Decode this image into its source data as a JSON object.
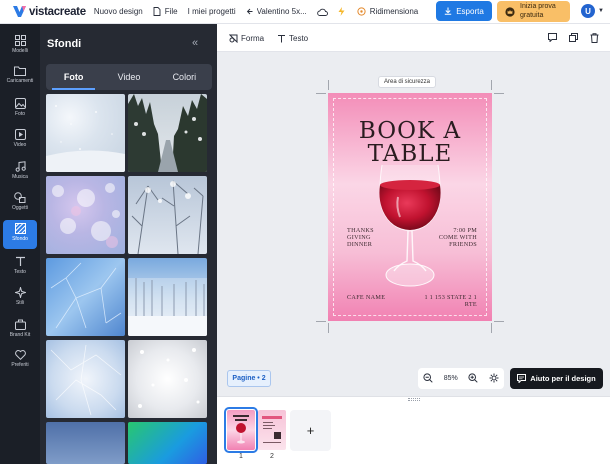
{
  "topbar": {
    "logo_text": "vistacreate",
    "new_design": "Nuovo design",
    "file": "File",
    "my_projects": "I miei progetti",
    "project_name": "Valentino 5x...",
    "resize": "Ridimensiona",
    "export": "Esporta",
    "trial_line1": "Inizia prova",
    "trial_line2": "gratuita",
    "avatar_letter": "U",
    "colors": {
      "export": "#1f79e3",
      "trial": "#f9bf67",
      "avatar": "#2364cf"
    }
  },
  "rail": {
    "items": [
      {
        "label": "Modelli",
        "icon": "templates-icon"
      },
      {
        "label": "Caricamenti",
        "icon": "folder-icon"
      },
      {
        "label": "Foto",
        "icon": "photo-icon"
      },
      {
        "label": "Video",
        "icon": "video-icon"
      },
      {
        "label": "Musica",
        "icon": "music-icon"
      },
      {
        "label": "Oggetti",
        "icon": "objects-icon"
      },
      {
        "label": "Sfondo",
        "icon": "background-icon"
      },
      {
        "label": "Testo",
        "icon": "text-icon"
      },
      {
        "label": "Stili",
        "icon": "styles-icon"
      },
      {
        "label": "Brand Kit",
        "icon": "brandkit-icon"
      },
      {
        "label": "Preferiti",
        "icon": "heart-icon"
      }
    ],
    "active_color": "#2c7be5"
  },
  "panel": {
    "title": "Sfondi",
    "collapse": "«",
    "tabs": [
      "Foto",
      "Video",
      "Colori"
    ],
    "active_tab": "Foto"
  },
  "toolbar2": {
    "shape": "Forma",
    "text": "Testo"
  },
  "canvas": {
    "safety_label": "Area di sicurezza",
    "title_line1": "BOOK A",
    "title_line2": "TABLE",
    "left_text": [
      "THANKS",
      "GIVING",
      "DINNER"
    ],
    "right_text": [
      "7:00 PM",
      "COME WITH",
      "FRIENDS"
    ],
    "cafe": "CAFE NAME",
    "address": "1 1 153 STATE 2 1 RTE"
  },
  "controls": {
    "pages": "Pagine • 2",
    "zoom": "85%",
    "help": "Aiuto per il design"
  },
  "strip": {
    "page_numbers": [
      "1",
      "2"
    ],
    "add": "+"
  }
}
